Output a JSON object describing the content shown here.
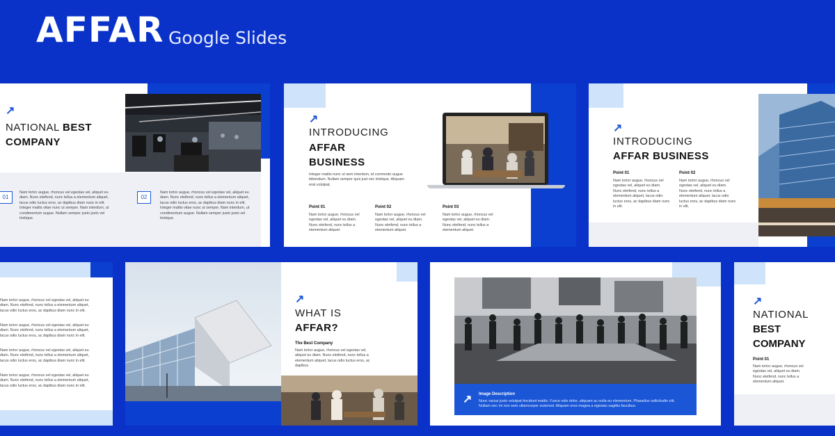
{
  "header": {
    "brand": "AFFAR",
    "subtitle": "Google Slides"
  },
  "colors": {
    "background": "#0a32c8",
    "accent": "#1a56d6",
    "light_accent": "#cfe3fb",
    "panel": "#eef0f5"
  },
  "slides": [
    {
      "title_light": "NATIONAL",
      "title_bold_inline": "BEST",
      "title_bold": "COMPANY",
      "items": [
        {
          "num": "01",
          "text": "Nam tortor augue, rhoncus vel egestas vel, aliquet eu diam. Nunc eleifend, nunc tellus a elementum aliquet, lacus odio luctus eros, ac dapibus diam nunc in elit. Integer mattis vitae nunc ut semper. Nam interdum, ut condimentum augue. Nullam semper justo justo vel tristique."
        },
        {
          "num": "02",
          "text": "Nam tortor augue, rhoncus vel egestas vel, aliquet eu diam. Nunc eleifend, nunc tellus a elementum aliquet, lacus odio luctus eros, ac dapibus diam nunc in elit. Integer mattis vitae nunc ut semper. Nam interdum, ut condimentum augue. Nullam semper justo justo vel tristique."
        }
      ]
    },
    {
      "title_light": "INTRODUCING",
      "title_bold_1": "AFFAR",
      "title_bold_2": "BUSINESS",
      "intro": "Integer mattis nunc ut sem interdum, id commodo augue bibendum. Nullam semper quis just nec tristique. Aliquam erat volutpat.",
      "points": [
        {
          "label": "Point 01",
          "text": "Nam tortor augue, rhoncus vel egestas vel, aliquet eu diam. Nunc eleifend, nunc tellus a elementum aliquet."
        },
        {
          "label": "Point 02",
          "text": "Nam tortor augue, rhoncus vel egestas vel, aliquet eu diam. Nunc eleifend, nunc tellus a elementum aliquet."
        },
        {
          "label": "Point 03",
          "text": "Nam tortor augue, rhoncus vel egestas vel, aliquet eu diam. Nunc eleifend, nunc tellus a elementum aliquet."
        }
      ]
    },
    {
      "title_light": "INTRODUCING",
      "title_bold": "AFFAR BUSINESS",
      "points": [
        {
          "label": "Point 01",
          "text": "Nam tortor augue, rhoncus vel egestas vel, aliquet eu diam. Nunc eleifend, nunc tellus a elementum aliquet, lacus odio luctus eros, ac dapibus diam nunc in elit."
        },
        {
          "label": "Point 02",
          "text": "Nam tortor augue, rhoncus vel egestas vel, aliquet eu diam. Nunc eleifend, nunc tellus a elementum aliquet, lacus odio luctus eros, ac dapibus diam nunc in elit."
        }
      ]
    },
    {
      "items": [
        "Nam tortor augue, rhoncus vel egestas vel, aliquet eu diam. Nunc eleifend, nunc tellus a elementum aliquet, lacus odio luctus eros, ac dapibus diam nunc in elit.",
        "Nam tortor augue, rhoncus vel egestas vel, aliquet eu diam. Nunc eleifend, nunc tellus a elementum aliquet, lacus odio luctus eros, ac dapibus diam nunc in elit.",
        "Nam tortor augue, rhoncus vel egestas vel, aliquet eu diam. Nunc eleifend, nunc tellus a elementum aliquet, lacus odio luctus eros, ac dapibus diam nunc in elit.",
        "Nam tortor augue, rhoncus vel egestas vel, aliquet eu diam. Nunc eleifend, nunc tellus a elementum aliquet, lacus odio luctus eros, ac dapibus diam nunc in elit."
      ]
    },
    {
      "title_light": "WHAT IS",
      "title_bold": "AFFAR?",
      "subhead": "The Best Company",
      "text": "Nam tortor augue, rhoncus vel egestas vel, aliquet eu diam. Nunc eleifend, nunc tellus a elementum aliquet, lacus odio luctus eros, ac dapibus."
    },
    {
      "caption_title": "Image Description",
      "caption_text": "Nunc varius justo volutpat tincidunt mattis. Fusce odio dolor, aliquam ac nulla eu elementum. Phasellus sollicitudin elit. Nullam nec mi non sem ullamcorper euismod. Aliquam eros magna a egestas sagittis faucibus."
    },
    {
      "title_light": "NATIONAL",
      "title_bold_1": "BEST",
      "title_bold_2": "COMPANY",
      "point_label": "Point 01",
      "point_text": "Nam tortor augue, rhoncus vel egestas vel, aliquet eu diam. Nunc eleifend, nunc tellus a elementum aliquet."
    }
  ]
}
